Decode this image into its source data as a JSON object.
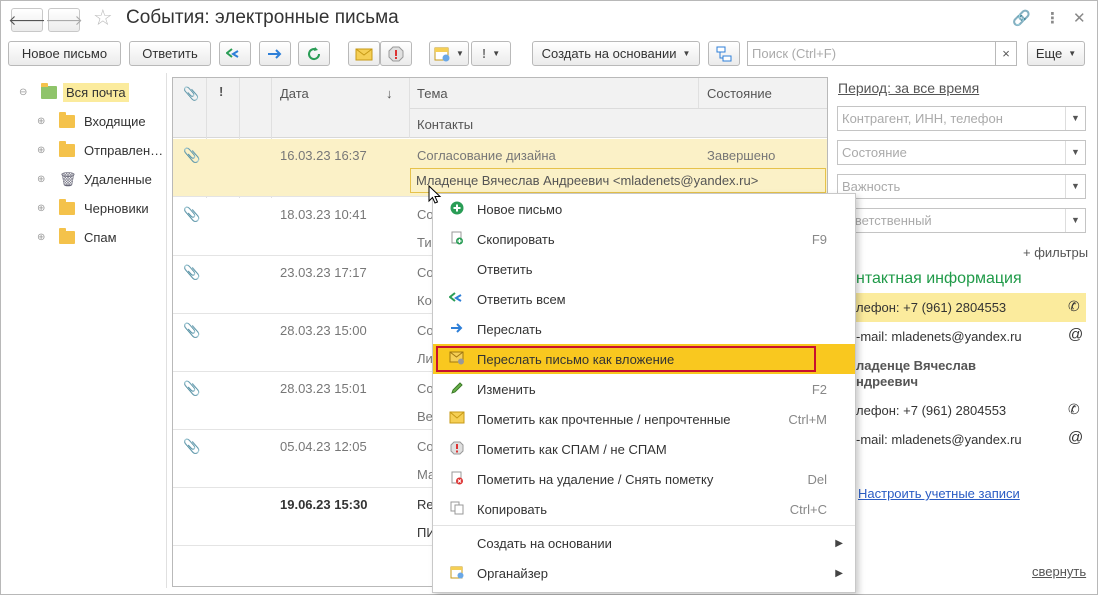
{
  "window": {
    "title": "События: электронные письма"
  },
  "toolbar": {
    "new_letter": "Новое письмо",
    "reply": "Ответить",
    "create_based": "Создать на основании",
    "search_placeholder": "Поиск (Ctrl+F)",
    "more": "Еще",
    "clear": "×"
  },
  "tree": {
    "items": [
      {
        "label": "Вся почта"
      },
      {
        "label": "Входящие"
      },
      {
        "label": "Отправлен…"
      },
      {
        "label": "Удаленные"
      },
      {
        "label": "Черновики"
      },
      {
        "label": "Спам"
      }
    ]
  },
  "table": {
    "headers": {
      "clip": "📎",
      "importance": "!",
      "date": "Дата",
      "sort": "↓",
      "subject": "Тема",
      "status": "Состояние",
      "contacts": "Контакты"
    },
    "rows": [
      {
        "date": "16.03.23 16:37",
        "subject": "Согласование дизайна",
        "status": "Завершено",
        "contact": "Младенце Вячеслав Андреевич <mladenets@yandex.ru>"
      },
      {
        "date": "18.03.23 10:41",
        "subject": "Со",
        "contact": "Ти"
      },
      {
        "date": "23.03.23 17:17",
        "subject": "Со",
        "contact": "Ко"
      },
      {
        "date": "28.03.23 15:00",
        "subject": "Со",
        "contact": "Ли"
      },
      {
        "date": "28.03.23 15:01",
        "subject": "Со",
        "contact": "Ве"
      },
      {
        "date": "05.04.23 12:05",
        "subject": "Со",
        "contact": "Ма"
      },
      {
        "date": "19.06.23 15:30",
        "subject": "Re",
        "contact": "ПИ"
      }
    ]
  },
  "right": {
    "period": "Период: за все время",
    "filters": [
      {
        "placeholder": "Контрагент, ИНН, телефон"
      },
      {
        "placeholder": "Состояние"
      },
      {
        "placeholder": "Важность"
      },
      {
        "placeholder": "ответственный"
      }
    ],
    "add_filters": "+ фильтры",
    "contact_heading": "нтактная информация",
    "phone1": "лефон: +7 (961) 2804553",
    "email1": "-mail: mladenets@yandex.ru",
    "person_line1": "ладенце Вячеслав",
    "person_line2": "ндреевич",
    "phone2": "лефон: +7 (961) 2804553",
    "email2": "-mail: mladenets@yandex.ru",
    "setup_accounts": "Настроить учетные записи",
    "collapse": "свернуть"
  },
  "context_menu": {
    "items": [
      {
        "label": "Новое письмо",
        "key": ""
      },
      {
        "label": "Скопировать",
        "key": "F9"
      },
      {
        "label": "Ответить",
        "key": ""
      },
      {
        "label": "Ответить всем",
        "key": ""
      },
      {
        "label": "Переслать",
        "key": ""
      },
      {
        "label": "Переслать письмо как вложение",
        "key": ""
      },
      {
        "label": "Изменить",
        "key": "F2"
      },
      {
        "label": "Пометить как прочтенные / непрочтенные",
        "key": "Ctrl+M"
      },
      {
        "label": "Пометить как СПАМ / не СПАМ",
        "key": ""
      },
      {
        "label": "Пометить на удаление / Снять пометку",
        "key": "Del"
      },
      {
        "label": "Копировать",
        "key": "Ctrl+C"
      },
      {
        "label": "Создать на основании",
        "key": ""
      },
      {
        "label": "Органайзер",
        "key": ""
      }
    ]
  },
  "colors": {
    "highlight": "#f9c81f",
    "selected_row": "#fbf1c7",
    "contact_green": "#1f9a48",
    "red_outline": "#c8102e"
  }
}
